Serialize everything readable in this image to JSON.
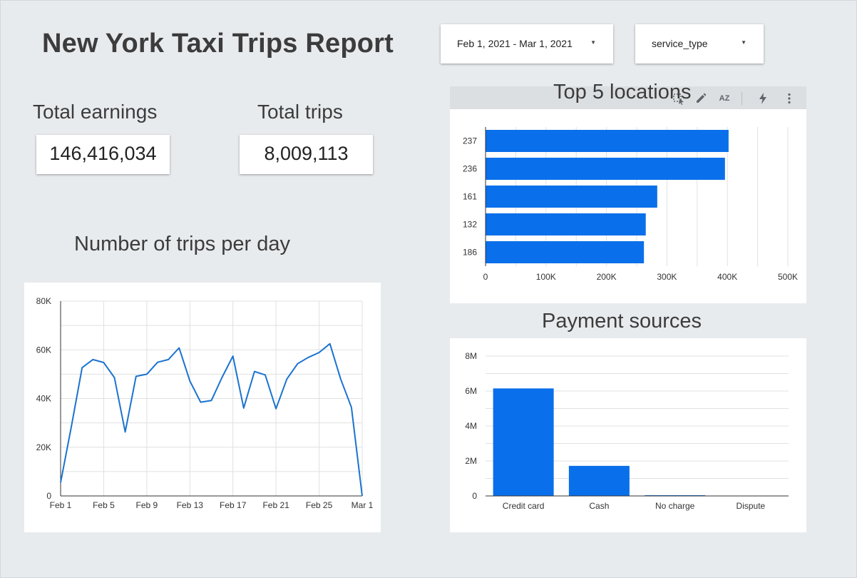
{
  "report": {
    "title": "New York Taxi Trips Report"
  },
  "controls": {
    "date_range": "Feb 1, 2021 - Mar 1, 2021",
    "filter": "service_type"
  },
  "kpis": {
    "earnings": {
      "label": "Total earnings",
      "value": "146,416,034"
    },
    "trips": {
      "label": "Total trips",
      "value": "8,009,113"
    }
  },
  "toolbar": {
    "icons": [
      "select-icon",
      "edit-icon",
      "sort-az-icon",
      "bolt-icon",
      "more-vert-icon"
    ],
    "sort_glyph": "AZ"
  },
  "colors": {
    "bar": "#0a6fea",
    "line": "#1a73d0",
    "grid": "#e0e0e0"
  },
  "chart_data": [
    {
      "type": "line",
      "title": "Number of trips per day",
      "x": [
        "Feb 1",
        "Feb 2",
        "Feb 3",
        "Feb 4",
        "Feb 5",
        "Feb 6",
        "Feb 7",
        "Feb 8",
        "Feb 9",
        "Feb 10",
        "Feb 11",
        "Feb 12",
        "Feb 13",
        "Feb 14",
        "Feb 15",
        "Feb 16",
        "Feb 17",
        "Feb 18",
        "Feb 19",
        "Feb 20",
        "Feb 21",
        "Feb 22",
        "Feb 23",
        "Feb 24",
        "Feb 25",
        "Feb 26",
        "Feb 27",
        "Feb 28",
        "Mar 1"
      ],
      "values": [
        5500,
        28500,
        52700,
        56000,
        54800,
        48600,
        26300,
        49100,
        50000,
        54900,
        56000,
        60800,
        47200,
        38500,
        39200,
        48800,
        57400,
        36100,
        51100,
        49700,
        35800,
        48000,
        54300,
        56900,
        58900,
        62500,
        48000,
        36400,
        0
      ],
      "x_ticks": [
        "Feb 1",
        "Feb 5",
        "Feb 9",
        "Feb 13",
        "Feb 17",
        "Feb 21",
        "Feb 25",
        "Mar 1"
      ],
      "y_ticks": [
        "0",
        "20K",
        "40K",
        "60K",
        "80K"
      ],
      "ylim": [
        0,
        80000
      ],
      "grid": true
    },
    {
      "type": "bar",
      "orientation": "horizontal",
      "title": "Top 5 locations",
      "categories": [
        "237",
        "236",
        "161",
        "132",
        "186"
      ],
      "values": [
        402000,
        396000,
        284000,
        265000,
        262000
      ],
      "x_ticks": [
        "0",
        "100K",
        "200K",
        "300K",
        "400K",
        "500K"
      ],
      "xlim": [
        0,
        500000
      ],
      "grid": true
    },
    {
      "type": "bar",
      "title": "Payment sources",
      "categories": [
        "Credit card",
        "Cash",
        "No charge",
        "Dispute"
      ],
      "values": [
        6150000,
        1720000,
        40000,
        20000
      ],
      "y_ticks": [
        "0",
        "2M",
        "4M",
        "6M",
        "8M"
      ],
      "ylim": [
        0,
        8000000
      ],
      "grid": true
    }
  ]
}
